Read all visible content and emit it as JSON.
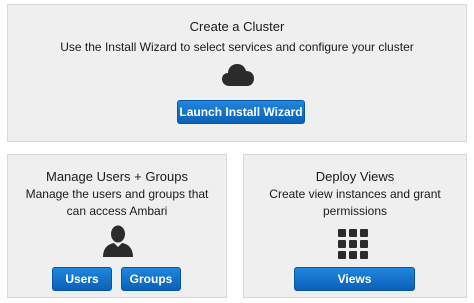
{
  "create_cluster": {
    "title": "Create a Cluster",
    "description": "Use the Install Wizard to select services and configure your cluster",
    "icon": "cloud-icon",
    "button_label": "Launch Install Wizard"
  },
  "manage_users": {
    "title": "Manage Users + Groups",
    "description": "Manage the users and groups that can access Ambari",
    "icon": "user-icon",
    "users_button_label": "Users",
    "groups_button_label": "Groups"
  },
  "deploy_views": {
    "title": "Deploy Views",
    "description": "Create view instances and grant permissions",
    "icon": "grid-icon",
    "button_label": "Views"
  },
  "colors": {
    "card_background": "#efefef",
    "button_blue": "#1070c8",
    "icon_dark": "#2b2b2b"
  }
}
